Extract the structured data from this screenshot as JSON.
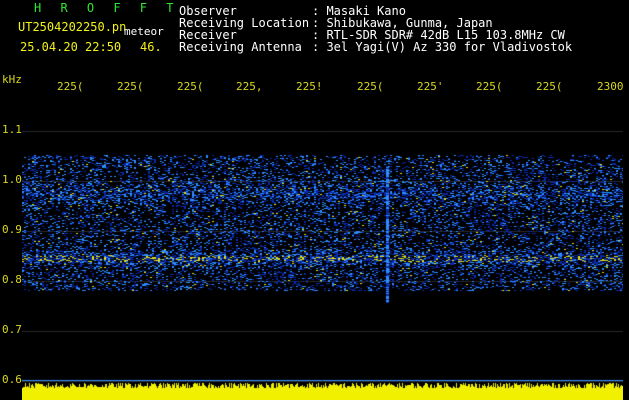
{
  "header": {
    "title": "H R O F F T",
    "filename": "UT2504202250.pn",
    "mode": "meteor",
    "datetime": "25.04.20 22:50",
    "seconds": "46.",
    "info_labels": [
      "Observer",
      "Receiving Location",
      "Receiver",
      "Receiving Antenna"
    ],
    "info_values": [
      ": Masaki Kano",
      ": Shibukawa, Gunma, Japan",
      ": RTL-SDR SDR# 42dB L15 103.8MHz CW",
      ": 3el Yagi(V) Az 330 for Vladivostok"
    ]
  },
  "axis": {
    "y_unit": "kHz",
    "y_ticks": [
      "1.1",
      "1.0",
      "0.9",
      "0.8",
      "0.7",
      "0.6"
    ],
    "x_ticks": [
      "225(",
      "225(",
      "225(",
      "225,",
      "225!",
      "225(",
      "225'",
      "225(",
      "225(",
      "2300"
    ]
  },
  "colors": {
    "background": "#000000",
    "text_white": "#ffffff",
    "text_green": "#2ee82e",
    "text_yellow": "#f2f21a",
    "grid": "#2a2a2a",
    "signal_low": "#0a2aa8",
    "signal_mid": "#2f8cff",
    "signal_high": "#e0e020",
    "level_bar": "#f0f000"
  },
  "spectrum": {
    "band_top_khz": 1.05,
    "band_bottom_khz": 0.78,
    "strong_line_khz": 0.845,
    "second_line_khz": 0.975,
    "meteor_time_fraction": 0.605
  }
}
